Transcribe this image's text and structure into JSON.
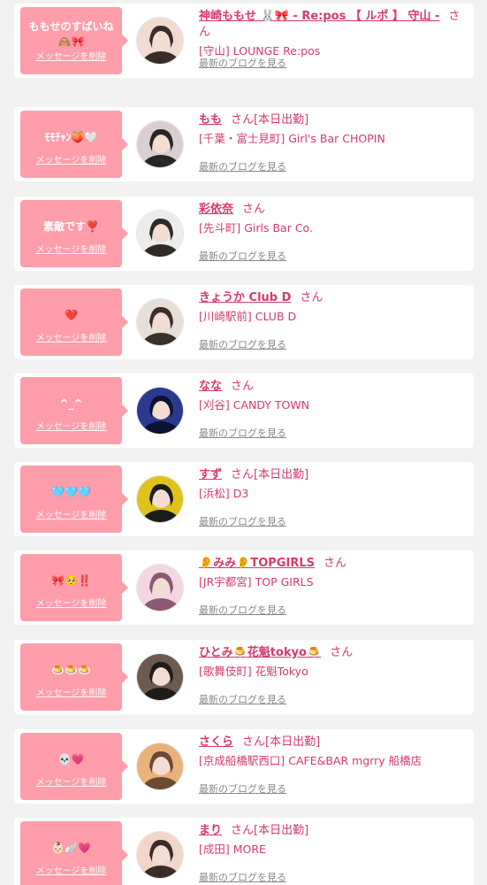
{
  "delete_label": "メッセージを削除",
  "blog_label": "最新のブログを見る",
  "san_label": "さん",
  "items": [
    {
      "message": "ももせのすばいね\n🙈🎀",
      "name": "神崎ももせ 🐰🎀 - Re:pos 【 ルポ 】 守山 -",
      "attend": "",
      "shop": "[守山] LOUNGE Re:pos",
      "avatar_colors": [
        "#f2d9d2",
        "#3b2c2a"
      ]
    },
    {
      "message": "ﾓﾓﾁｬﾝ🍑🤍",
      "name": "もも",
      "attend": "[本日出勤]",
      "shop": "[千葉・富士見町] Girl's Bar CHOPIN",
      "avatar_colors": [
        "#d9cfd0",
        "#2a2526"
      ]
    },
    {
      "message": "素敵です❣️",
      "name": "彩依奈",
      "attend": "",
      "shop": "[先斗町] Girls Bar Co.",
      "avatar_colors": [
        "#ececec",
        "#2e2a28"
      ]
    },
    {
      "message": "❤️",
      "name": "きょうか Club D",
      "attend": "",
      "shop": "[川崎駅前] CLUB D",
      "avatar_colors": [
        "#e8ded9",
        "#3a2f2b"
      ]
    },
    {
      "message": "^_^",
      "name": "なな",
      "attend": "",
      "shop": "[刈谷] CANDY TOWN",
      "avatar_colors": [
        "#2b3a8f",
        "#0c1330"
      ]
    },
    {
      "message": "🩵🩵🩵",
      "name": "すず",
      "attend": "[本日出勤]",
      "shop": "[浜松] D3",
      "avatar_colors": [
        "#e0c21a",
        "#1c1c1c"
      ]
    },
    {
      "message": "🎀🥺‼️",
      "name": "👂みみ👂TOPGIRLS",
      "attend": "",
      "shop": "[JR宇都宮] TOP GIRLS",
      "avatar_colors": [
        "#f4d6e3",
        "#8a5a72"
      ]
    },
    {
      "message": "🍮🍮🍮",
      "name": "ひとみ🍮花魁tokyo🍮",
      "attend": "",
      "shop": "[歌舞伎町] 花魁Tokyo",
      "avatar_colors": [
        "#6b5a4e",
        "#1f1b19"
      ]
    },
    {
      "message": "💀💗",
      "name": "さくら",
      "attend": "[本日出勤]",
      "shop": "[京成船橋駅西口] CAFE&BAR mgrry 船橋店",
      "avatar_colors": [
        "#e9b27a",
        "#6b4a33"
      ]
    },
    {
      "message": "👶🏻🪽💗",
      "name": "まり",
      "attend": "[本日出勤]",
      "shop": "[成田] MORE",
      "avatar_colors": [
        "#f1d5c8",
        "#3d2b2a"
      ]
    }
  ]
}
